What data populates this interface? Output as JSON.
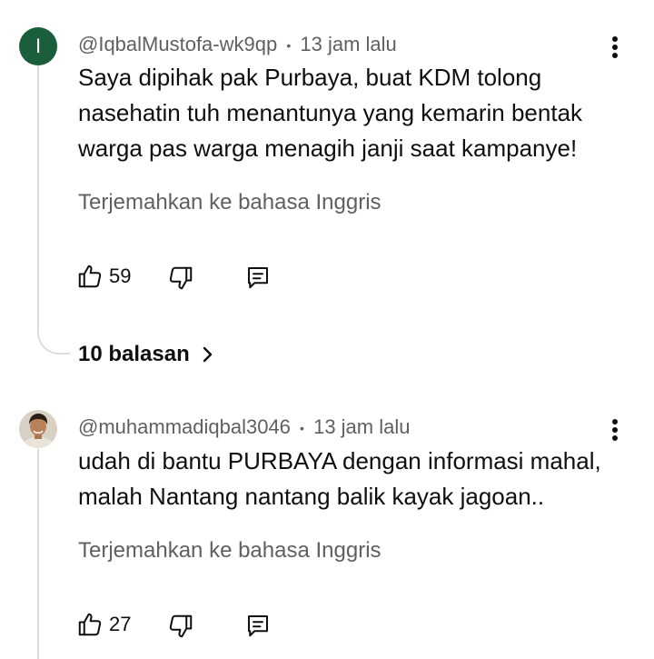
{
  "comments": [
    {
      "avatar_letter": "I",
      "avatar_color": "#1b5e3b",
      "author": "@IqbalMustofa-wk9qp",
      "separator": "•",
      "time": "13 jam lalu",
      "lines": [
        "Saya dipihak pak Purbaya, buat KDM tolong",
        "nasehatin tuh menantunya yang kemarin bentak",
        "warga pas warga menagih janji saat kampanye!"
      ],
      "translate_label": "Terjemahkan ke bahasa Inggris",
      "likes": "59",
      "replies_label": "10 balasan",
      "icons": [
        "thumb-up-icon",
        "thumb-down-icon",
        "reply-icon",
        "more-vert-icon",
        "chevron-right-icon"
      ]
    },
    {
      "avatar_desc": "photo",
      "author": "@muhammadiqbal3046",
      "separator": "•",
      "time": "13 jam lalu",
      "lines": [
        "udah di bantu PURBAYA dengan informasi mahal,",
        "malah Nantang nantang balik kayak jagoan.."
      ],
      "translate_label": "Terjemahkan ke bahasa Inggris",
      "likes": "27",
      "icons": [
        "thumb-up-icon",
        "thumb-down-icon",
        "reply-icon",
        "more-vert-icon"
      ]
    }
  ],
  "colors": {
    "text": "#0f0f0f",
    "secondary": "#606060",
    "thread_line": "#dddddd"
  }
}
